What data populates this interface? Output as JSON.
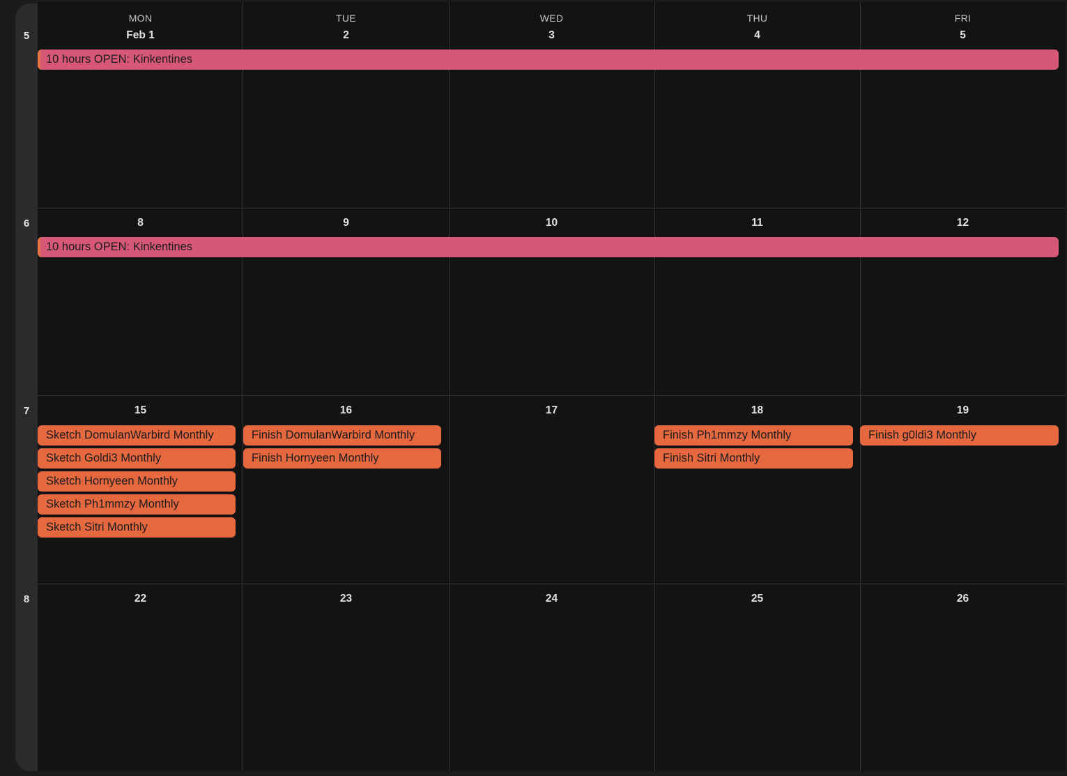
{
  "colors": {
    "background": "#131314",
    "grid_line": "#333538",
    "event_pink": "#d65876",
    "event_orange": "#e5683f",
    "week_rail": "#2b2b2d"
  },
  "day_headers": [
    "MON",
    "TUE",
    "WED",
    "THU",
    "FRI"
  ],
  "weeks": [
    {
      "week_number": "5",
      "dates": [
        "Feb 1",
        "2",
        "3",
        "4",
        "5"
      ],
      "spanning_event": {
        "label": "10 hours OPEN: Kinkentines"
      },
      "day_events": [
        [],
        [],
        [],
        [],
        []
      ]
    },
    {
      "week_number": "6",
      "dates": [
        "8",
        "9",
        "10",
        "11",
        "12"
      ],
      "spanning_event": {
        "label": "10 hours OPEN: Kinkentines"
      },
      "day_events": [
        [],
        [],
        [],
        [],
        []
      ]
    },
    {
      "week_number": "7",
      "dates": [
        "15",
        "16",
        "17",
        "18",
        "19"
      ],
      "spanning_event": null,
      "day_events": [
        [
          "Sketch DomulanWarbird Monthly",
          "Sketch Goldi3 Monthly",
          "Sketch Hornyeen Monthly",
          "Sketch Ph1mmzy Monthly",
          "Sketch Sitri Monthly"
        ],
        [
          "Finish DomulanWarbird Monthly",
          "Finish Hornyeen Monthly"
        ],
        [],
        [
          "Finish Ph1mmzy Monthly",
          "Finish Sitri Monthly"
        ],
        [
          "Finish g0ldi3 Monthly"
        ]
      ]
    },
    {
      "week_number": "8",
      "dates": [
        "22",
        "23",
        "24",
        "25",
        "26"
      ],
      "spanning_event": null,
      "day_events": [
        [],
        [],
        [],
        [],
        []
      ]
    }
  ]
}
